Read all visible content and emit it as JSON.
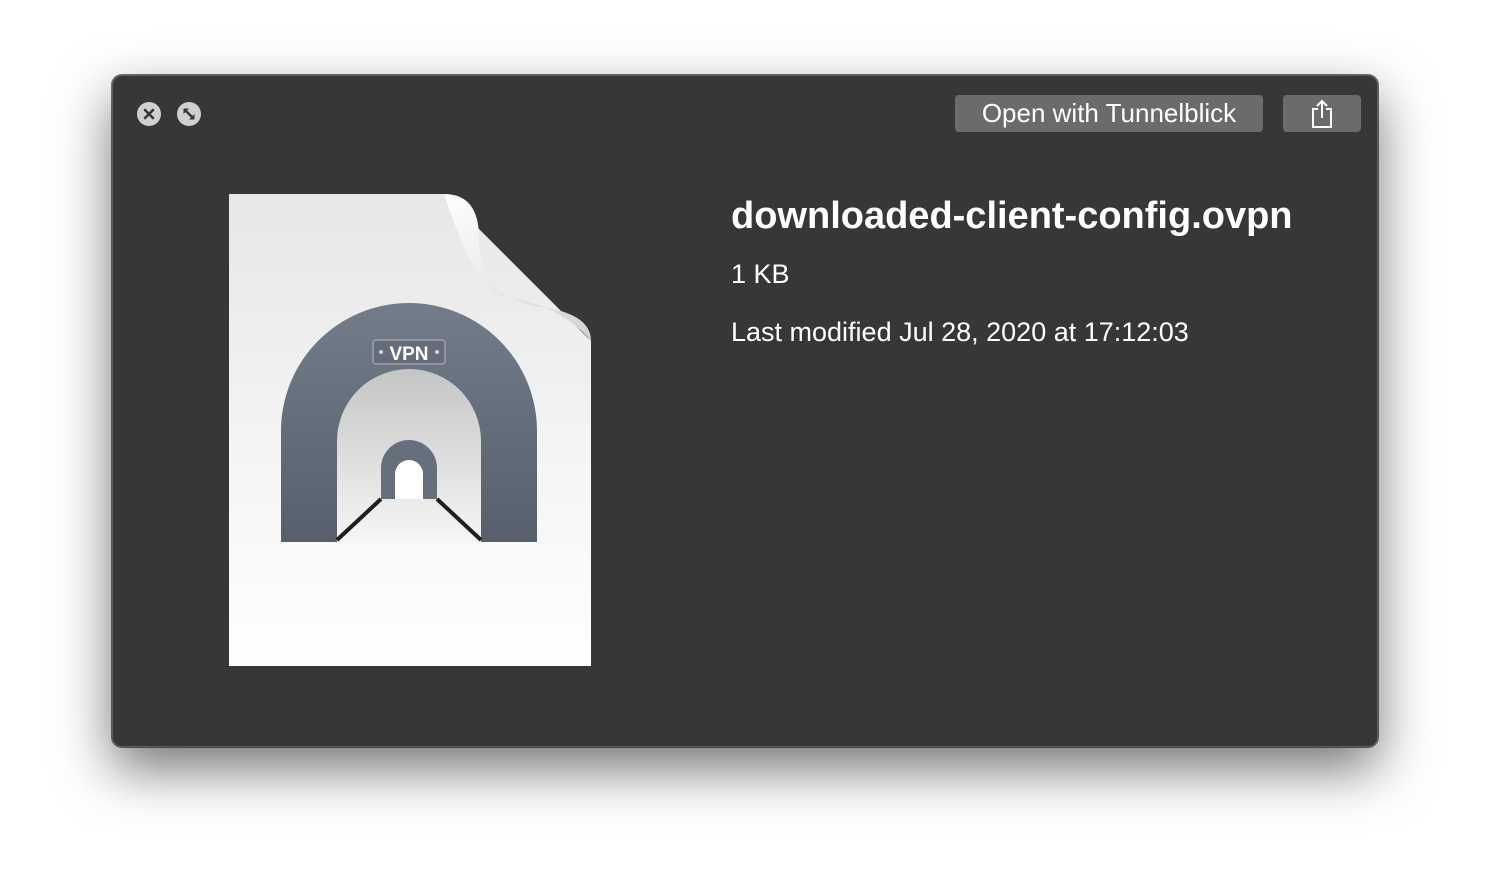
{
  "window": {
    "controls": {
      "close_icon": "close-icon",
      "fullscreen_icon": "fullscreen-icon"
    },
    "toolbar": {
      "open_with_label": "Open with Tunnelblick",
      "share_icon": "share-icon"
    }
  },
  "preview": {
    "icon": "vpn-tunnel-document-icon",
    "icon_badge": "VPN"
  },
  "file": {
    "name": "downloaded-client-config.ovpn",
    "size": "1 KB",
    "modified": "Last modified Jul 28, 2020 at 17:12:03"
  },
  "colors": {
    "window_background": "#363737",
    "button_background": "#6a6b6b",
    "text": "#ffffff"
  }
}
